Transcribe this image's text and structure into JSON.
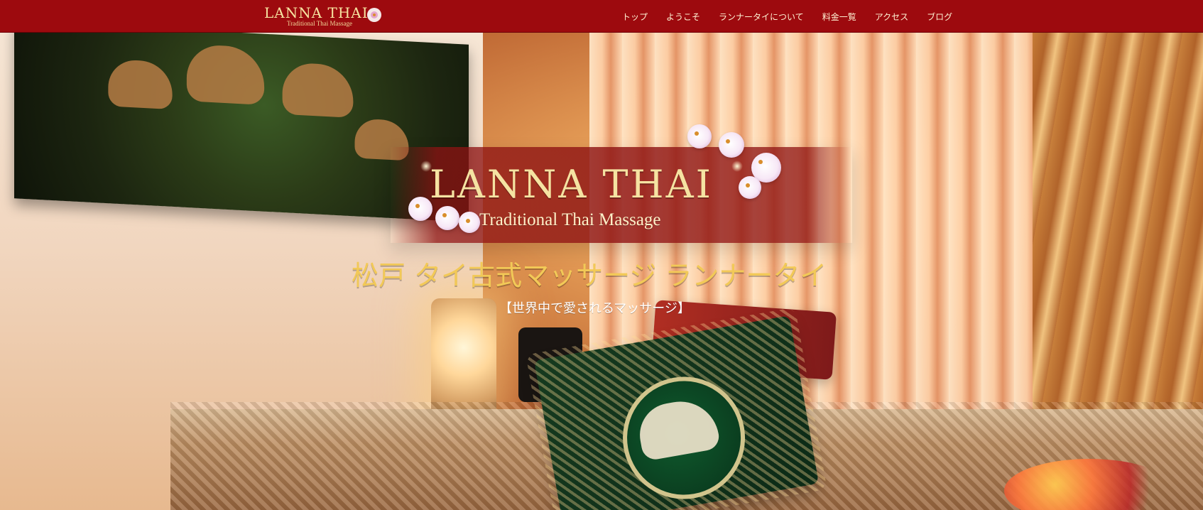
{
  "header": {
    "brand": {
      "title": "LANNA THAI",
      "subtitle": "Traditional Thai Massage"
    },
    "nav": [
      {
        "label": "トップ"
      },
      {
        "label": "ようこそ"
      },
      {
        "label": "ランナータイについて"
      },
      {
        "label": "料金一覧"
      },
      {
        "label": "アクセス"
      },
      {
        "label": "ブログ"
      }
    ]
  },
  "hero": {
    "logo_title": "LANNA THAI",
    "logo_subtitle": "Traditional Thai Massage",
    "headline": "松戸 タイ古式マッサージ ランナータイ",
    "tagline": "【世界中で愛されるマッサージ】"
  },
  "colors": {
    "header_bg": "#9d0a0e",
    "gold": "#f2c957",
    "banner_red": "#8d1212"
  },
  "icons": {
    "orchid": "orchid-icon",
    "sparkle": "sparkle-icon"
  }
}
